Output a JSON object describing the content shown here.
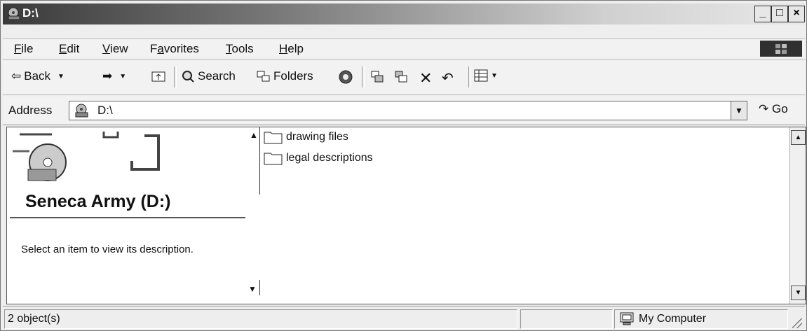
{
  "window": {
    "title": "D:\\",
    "controls": {
      "minimize": "_",
      "maximize": "□",
      "close": "×"
    }
  },
  "menu": [
    "File",
    "Edit",
    "View",
    "Favorites",
    "Tools",
    "Help"
  ],
  "menu_mnemonic": [
    "F",
    "E",
    "V",
    "a",
    "T",
    "H"
  ],
  "toolbar": {
    "back": "Back",
    "search": "Search",
    "folders": "Folders"
  },
  "address": {
    "label": "Address",
    "value": "D:\\",
    "go": "Go"
  },
  "left_pane": {
    "drive_title": "Seneca Army (D:)",
    "description": "Select an item to view its description."
  },
  "files": [
    {
      "name": "drawing files",
      "icon": "folder-icon"
    },
    {
      "name": "legal descriptions",
      "icon": "folder-icon"
    }
  ],
  "status": {
    "count": "2 object(s)",
    "zone": "My Computer"
  }
}
